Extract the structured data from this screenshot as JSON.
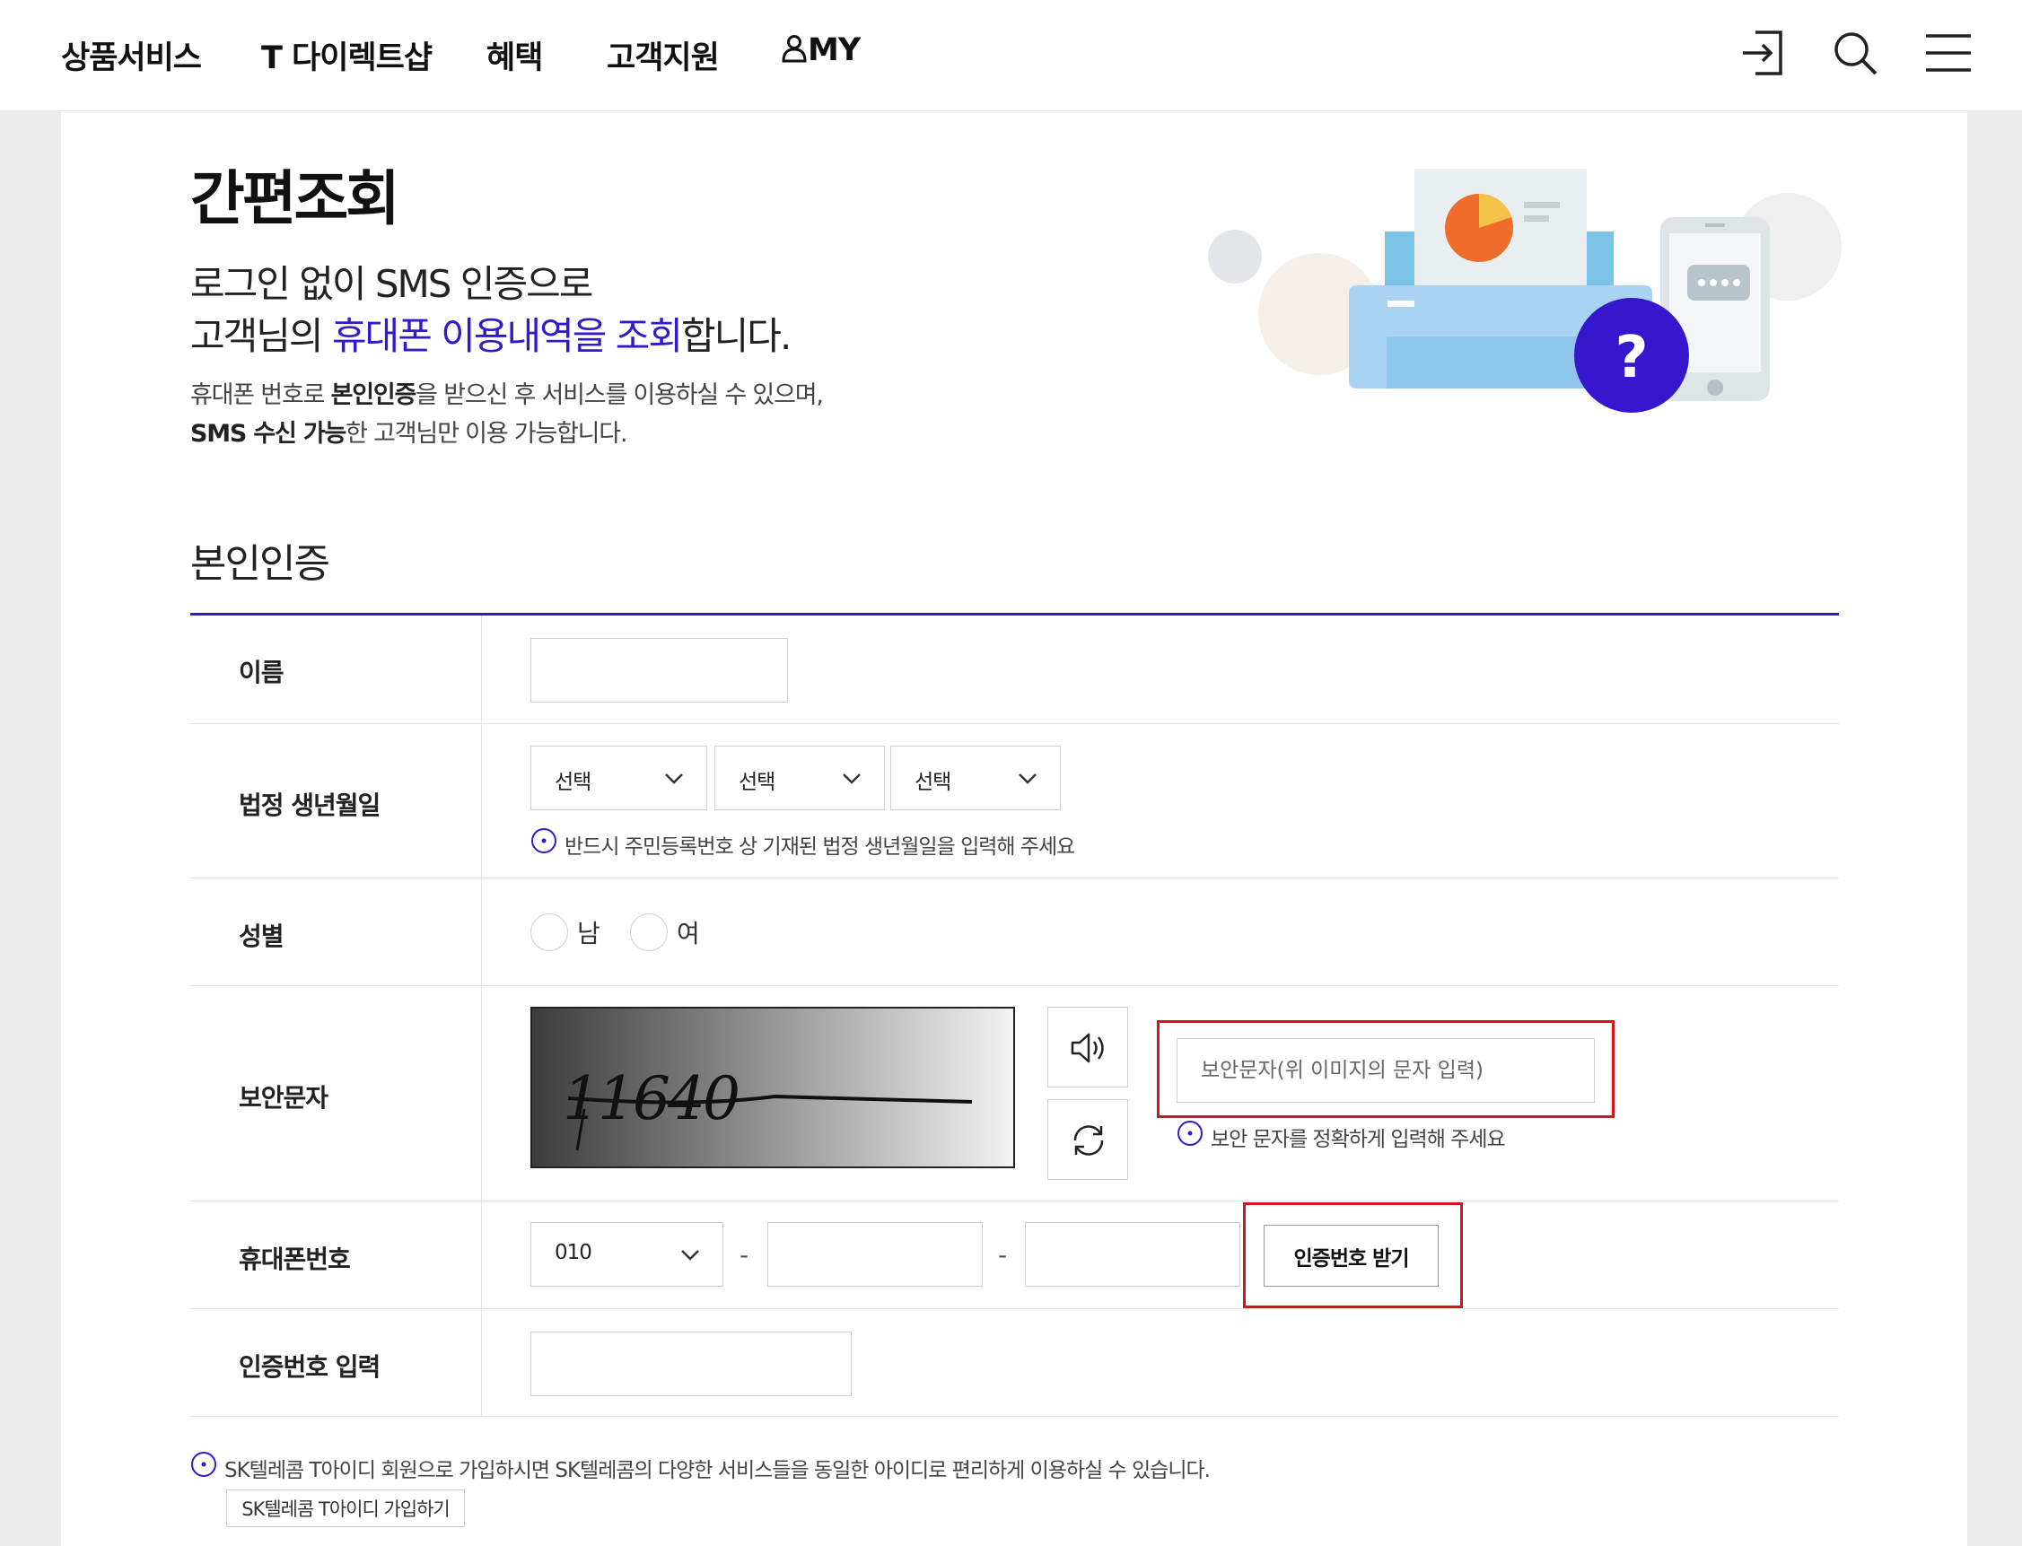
{
  "nav": {
    "items": [
      "상품서비스",
      "T 다이렉트샵",
      "혜택",
      "고객지원",
      "MY"
    ]
  },
  "page": {
    "title": "간편조회",
    "lead_line1": "로그인 없이 SMS 인증으로",
    "lead_line2_pre": "고객님의 ",
    "lead_line2_highlight": "휴대폰 이용내역을 조회",
    "lead_line2_post": "합니다.",
    "desc_line1_pre": "휴대폰 번호로 ",
    "desc_line1_bold": "본인인증",
    "desc_line1_post": "을 받으신 후 서비스를 이용하실 수 있으며,",
    "desc_line2_bold": "SMS 수신 가능",
    "desc_line2_post": "한 고객님만 이용 가능합니다.",
    "illustration_mark": "?"
  },
  "form": {
    "section_title": "본인인증",
    "name_label": "이름",
    "name_value": "",
    "birth_label": "법정 생년월일",
    "birth_selects": [
      "선택",
      "선택",
      "선택"
    ],
    "birth_notice": "반드시 주민등록번호 상 기재된 법정 생년월일을 입력해 주세요",
    "gender_label": "성별",
    "gender_options": [
      "남",
      "여"
    ],
    "captcha_label": "보안문자",
    "captcha_text": "11640",
    "captcha_placeholder": "보안문자(위 이미지의 문자 입력)",
    "captcha_notice": "보안 문자를 정확하게 입력해 주세요",
    "phone_label": "휴대폰번호",
    "phone_prefix": "010",
    "phone_dash": "-",
    "cert_button": "인증번호 받기",
    "cert_input_label": "인증번호 입력",
    "cert_value": ""
  },
  "footer": {
    "notice": "SK텔레콤 T아이디 회원으로 가입하시면 SK텔레콤의 다양한 서비스들을 동일한 아이디로 편리하게 이용하실 수 있습니다.",
    "join_button": "SK텔레콤 T아이디 가입하기"
  },
  "colors": {
    "accent": "#3617ce",
    "highlight_box": "#d9131a"
  }
}
